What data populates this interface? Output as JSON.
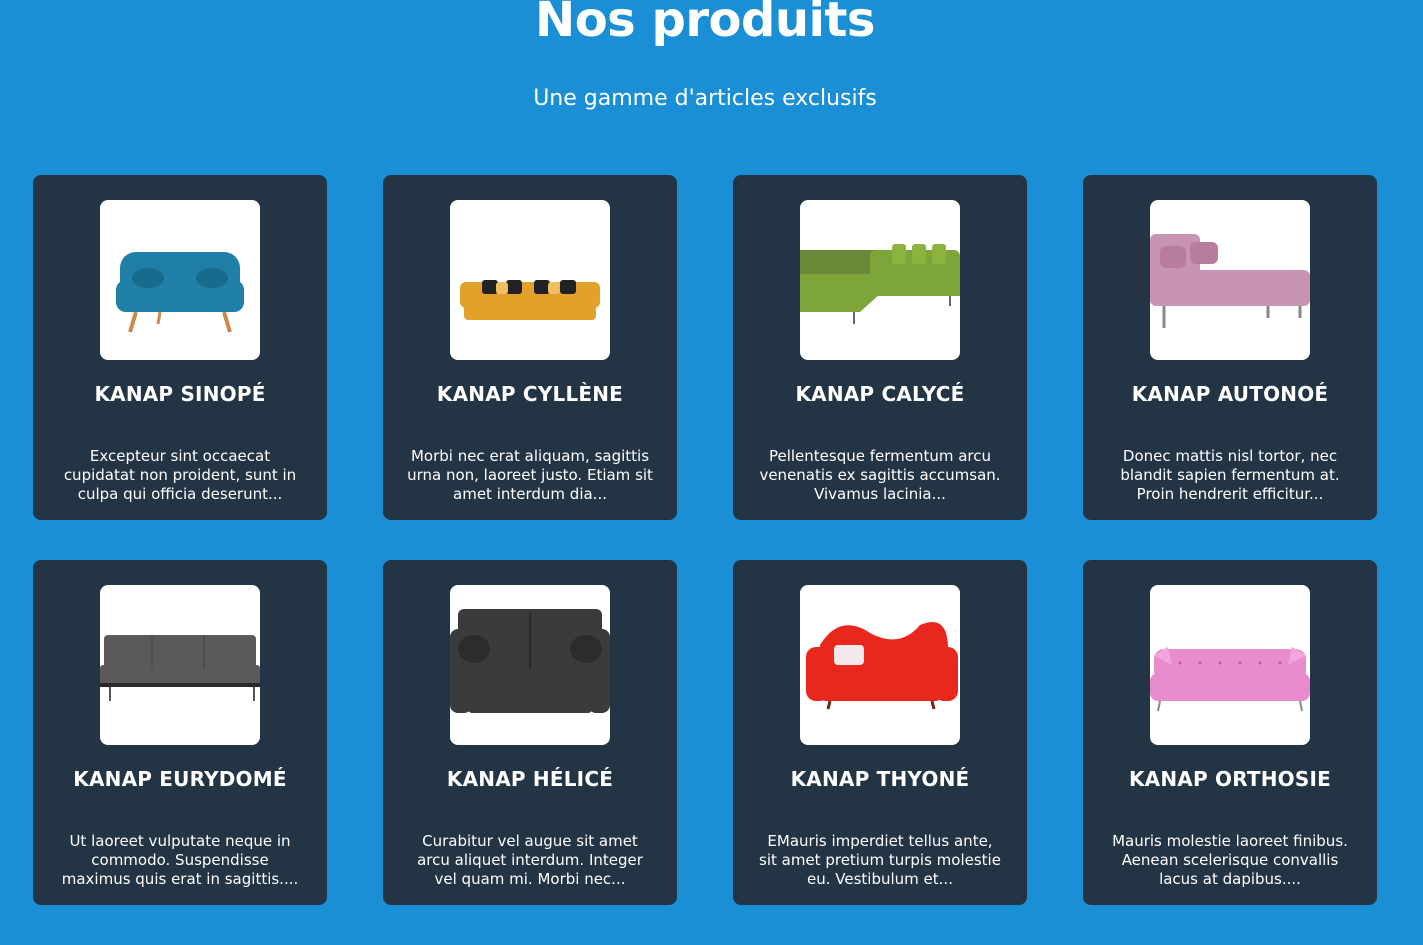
{
  "header": {
    "title": "Nos produits",
    "subtitle": "Une gamme d'articles exclusifs"
  },
  "products": [
    {
      "name": "KANAP SINOPÉ",
      "description": "Excepteur sint occaecat cupidatat non proident, sunt in culpa qui officia deserunt...",
      "color": "#1f7fa6"
    },
    {
      "name": "KANAP CYLLÈNE",
      "description": "Morbi nec erat aliquam, sagittis urna non, laoreet justo. Etiam sit amet interdum dia...",
      "color": "#e2a12a"
    },
    {
      "name": "KANAP CALYCÉ",
      "description": "Pellentesque fermentum arcu venenatis ex sagittis accumsan. Vivamus lacinia...",
      "color": "#7ea53a"
    },
    {
      "name": "KANAP AUTONOÉ",
      "description": "Donec mattis nisl tortor, nec blandit sapien fermentum at. Proin hendrerit efficitur...",
      "color": "#c994b2"
    },
    {
      "name": "KANAP EURYDOMÉ",
      "description": "Ut laoreet vulputate neque in commodo. Suspendisse maximus quis erat in sagittis....",
      "color": "#5a5a5c"
    },
    {
      "name": "KANAP HÉLICÉ",
      "description": "Curabitur vel augue sit amet arcu aliquet interdum. Integer vel quam mi. Morbi nec...",
      "color": "#3b3b3d"
    },
    {
      "name": "KANAP THYONÉ",
      "description": "EMauris imperdiet tellus ante, sit amet pretium turpis molestie eu. Vestibulum et...",
      "color": "#e8281c"
    },
    {
      "name": "KANAP ORTHOSIE",
      "description": "Mauris molestie laoreet finibus. Aenean scelerisque convallis lacus at dapibus....",
      "color": "#e98ccd"
    }
  ]
}
